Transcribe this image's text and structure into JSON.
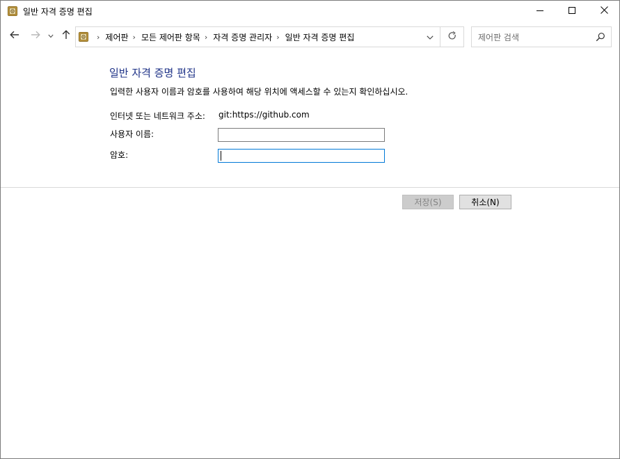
{
  "window": {
    "title": "일반 자격 증명 편집",
    "icon": "control-panel-icon"
  },
  "nav": {
    "breadcrumbs": [
      "제어판",
      "모든 제어판 항목",
      "자격 증명 관리자",
      "일반 자격 증명 편집"
    ],
    "search_placeholder": "제어판 검색"
  },
  "form": {
    "heading": "일반 자격 증명 편집",
    "instruction": "입력한 사용자 이름과 암호를 사용하여 해당 위치에 액세스할 수 있는지 확인하십시오.",
    "address_label": "인터넷 또는 네트워크 주소:",
    "address_value": "git:https://github.com",
    "username_label": "사용자 이름:",
    "username_value": "",
    "password_label": "암호:",
    "password_value": ""
  },
  "buttons": {
    "save_label": "저장(S)",
    "cancel_label": "취소(N)"
  },
  "colors": {
    "heading": "#1e3287",
    "focus_border": "#0078d7",
    "disabled_button_bg": "#cccccc"
  }
}
